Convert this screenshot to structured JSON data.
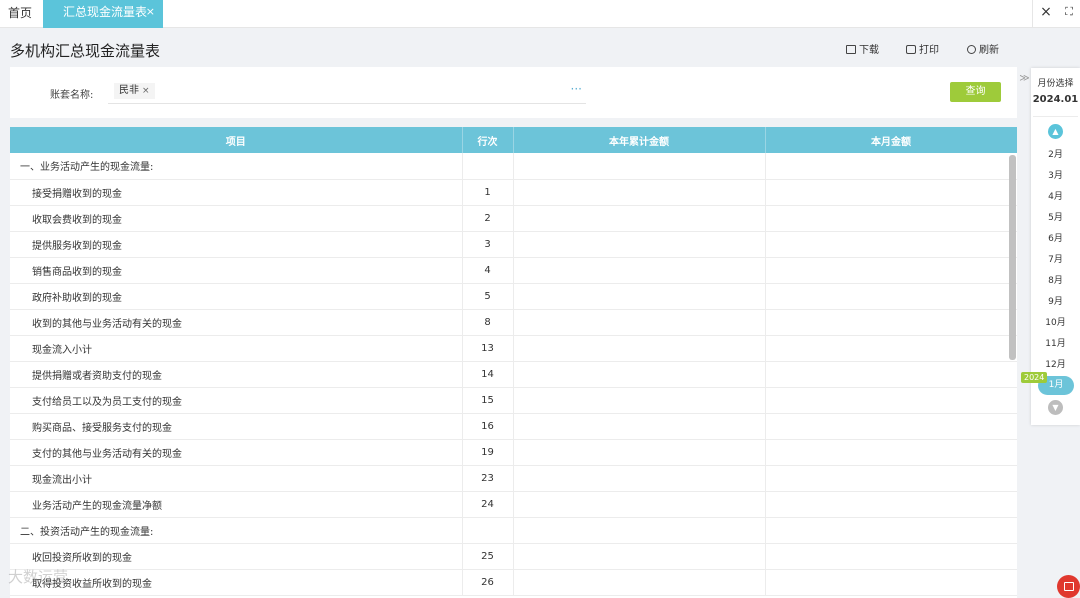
{
  "tabs": {
    "home": "首页",
    "active": "汇总现金流量表",
    "close": "×"
  },
  "window": {
    "close": "×",
    "fullscreen": "⛶"
  },
  "page": {
    "title": "多机构汇总现金流量表"
  },
  "toolbar": {
    "download": "下载",
    "print": "打印",
    "refresh": "刷新"
  },
  "filter": {
    "label": "账套名称:",
    "chip": "民非",
    "chip_remove": "×",
    "more": "···",
    "query": "查询"
  },
  "table": {
    "headers": [
      "项目",
      "行次",
      "本年累计金额",
      "本月金额"
    ],
    "rows": [
      {
        "item": "一、业务活动产生的现金流量:",
        "line": "",
        "year": "",
        "month": ""
      },
      {
        "item": "接受捐赠收到的现金",
        "line": "1",
        "year": "",
        "month": ""
      },
      {
        "item": "收取会费收到的现金",
        "line": "2",
        "year": "",
        "month": ""
      },
      {
        "item": "提供服务收到的现金",
        "line": "3",
        "year": "",
        "month": ""
      },
      {
        "item": "销售商品收到的现金",
        "line": "4",
        "year": "",
        "month": ""
      },
      {
        "item": "政府补助收到的现金",
        "line": "5",
        "year": "",
        "month": ""
      },
      {
        "item": "收到的其他与业务活动有关的现金",
        "line": "8",
        "year": "",
        "month": ""
      },
      {
        "item": "现金流入小计",
        "line": "13",
        "year": "",
        "month": ""
      },
      {
        "item": "提供捐赠或者资助支付的现金",
        "line": "14",
        "year": "",
        "month": ""
      },
      {
        "item": "支付给员工以及为员工支付的现金",
        "line": "15",
        "year": "",
        "month": ""
      },
      {
        "item": "购买商品、接受服务支付的现金",
        "line": "16",
        "year": "",
        "month": ""
      },
      {
        "item": "支付的其他与业务活动有关的现金",
        "line": "19",
        "year": "",
        "month": ""
      },
      {
        "item": "现金流出小计",
        "line": "23",
        "year": "",
        "month": ""
      },
      {
        "item": "业务活动产生的现金流量净额",
        "line": "24",
        "year": "",
        "month": ""
      },
      {
        "item": "二、投资活动产生的现金流量:",
        "line": "",
        "year": "",
        "month": ""
      },
      {
        "item": "收回投资所收到的现金",
        "line": "25",
        "year": "",
        "month": ""
      },
      {
        "item": "取得投资收益所收到的现金",
        "line": "26",
        "year": "",
        "month": ""
      }
    ]
  },
  "period": {
    "title": "月份选择",
    "current": "2024.01",
    "months": [
      "2月",
      "3月",
      "4月",
      "5月",
      "6月",
      "7月",
      "8月",
      "9月",
      "10月",
      "11月",
      "12月"
    ],
    "year_badge": "2024",
    "selected": "1月",
    "expand": "≫"
  },
  "watermark": "大数运营"
}
